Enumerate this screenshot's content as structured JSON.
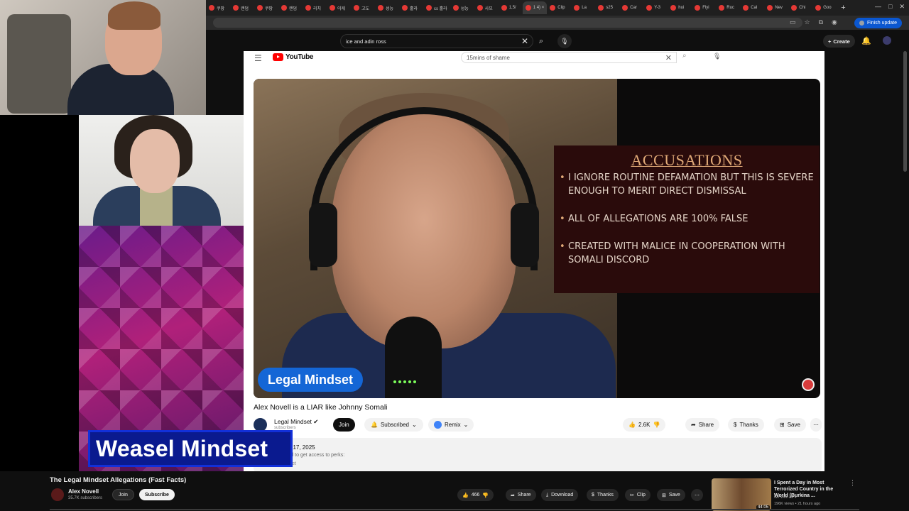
{
  "browser": {
    "tabs": [
      {
        "label": "쿠팡"
      },
      {
        "label": "랜덤"
      },
      {
        "label": "쿠팡"
      },
      {
        "label": "랜덤"
      },
      {
        "label": "리치"
      },
      {
        "label": "이케"
      },
      {
        "label": "고도"
      },
      {
        "label": "성능"
      },
      {
        "label": "홀라"
      },
      {
        "label": "cs 홀라"
      },
      {
        "label": "성능"
      },
      {
        "label": "사모"
      },
      {
        "label": "1,5/"
      },
      {
        "label": "1 4) ×",
        "active": true
      },
      {
        "label": "Clip"
      },
      {
        "label": "La"
      },
      {
        "label": "s25"
      },
      {
        "label": "Car"
      },
      {
        "label": "Y-3"
      },
      {
        "label": "hui"
      },
      {
        "label": "Flyi"
      },
      {
        "label": "Ruc"
      },
      {
        "label": "Cal"
      },
      {
        "label": "Nev"
      },
      {
        "label": "Chi"
      },
      {
        "label": "Goo"
      }
    ],
    "new_tab": "+",
    "window_controls": [
      "—",
      "□",
      "✕"
    ],
    "finish_update": "Finish update"
  },
  "outer_header": {
    "search_value": "ice and adin ross",
    "create_label": "Create"
  },
  "inner": {
    "logo_text": "YouTube",
    "search_value": "15mins of shame",
    "video": {
      "panel_title": "ACCUSATIONS",
      "bullets": [
        "I IGNORE ROUTINE DEFAMATION BUT THIS IS SEVERE ENOUGH TO MERIT DIRECT DISMISSAL",
        "ALL OF ALLEGATIONS ARE 100% FALSE",
        "CREATED WITH MALICE IN COOPERATION WITH SOMALI DISCORD"
      ],
      "badge": "Legal Mindset"
    },
    "title": "Alex Novell is a LIAR like Johnny Somali",
    "channel": {
      "name": "Legal Mindset ✔",
      "subs": "subscribers",
      "join": "Join",
      "subscribed": "Subscribed",
      "remix": "Remix"
    },
    "actions": {
      "likes": "2.6K",
      "share": "Share",
      "thanks": "Thanks",
      "save": "Save",
      "more": "⋯"
    },
    "description": {
      "date": "Jul 17, 2025",
      "perks": "nnel to get access to perks:",
      "mindset": "ndset"
    }
  },
  "overlay": {
    "weasel_banner": "Weasel Mindset"
  },
  "bottom": {
    "title": "The Legal Mindset Allegations (Fast Facts)",
    "channel_name": "Alex Novell",
    "subs": "35.7K subscribers",
    "join": "Join",
    "subscribe": "Subscribe",
    "likes": "466",
    "share": "Share",
    "download": "Download",
    "thanks": "Thanks",
    "clip": "Clip",
    "save": "Save",
    "more": "⋯",
    "rec": {
      "title": "I Spent a Day in Most Terrorized Country in the World (Burkina ...",
      "channel": "Go With Ali ✔",
      "meta": "196K views • 21 hours ago",
      "duration": "44:05"
    }
  }
}
